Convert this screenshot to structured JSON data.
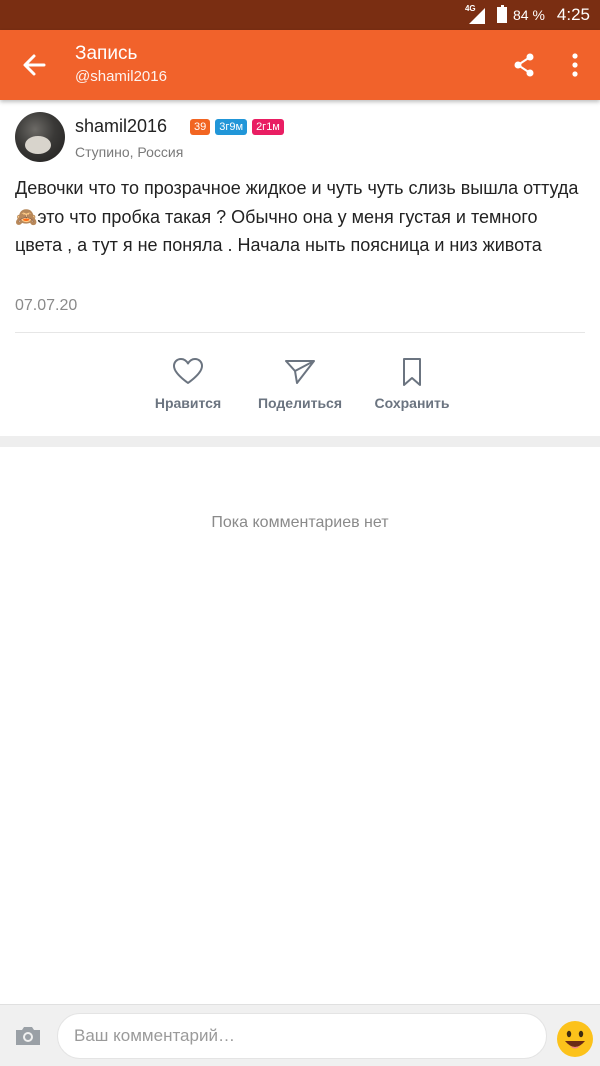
{
  "status_bar": {
    "network": "4G",
    "battery_percent": "84 %",
    "time": "4:25"
  },
  "header": {
    "title": "Запись",
    "subtitle": "@shamil2016",
    "icons": [
      "back-arrow-icon",
      "share-icon",
      "more-vertical-icon"
    ],
    "accent_color": "#f1622b"
  },
  "post": {
    "author": "shamil2016",
    "badges": [
      {
        "text": "39",
        "color": "#f26522"
      },
      {
        "text": "3г9м",
        "color": "#2196d8"
      },
      {
        "text": "2г1м",
        "color": "#e91e63"
      }
    ],
    "location": "Ступино, Россия",
    "text": "Девочки что то прозрачное жидкое и чуть чуть слизь вышла оттуда 🙈это что пробка такая ? Обычно она у меня густая и темного цвета , а тут я не поняла . Начала ныть поясница и низ живота",
    "date": "07.07.20"
  },
  "actions": {
    "like": "Нравится",
    "share": "Поделиться",
    "save": "Сохранить"
  },
  "comments": {
    "empty_text": "Пока комментариев нет"
  },
  "comment_input": {
    "placeholder": "Ваш комментарий…",
    "icons": [
      "camera-icon",
      "emoji-icon"
    ]
  }
}
